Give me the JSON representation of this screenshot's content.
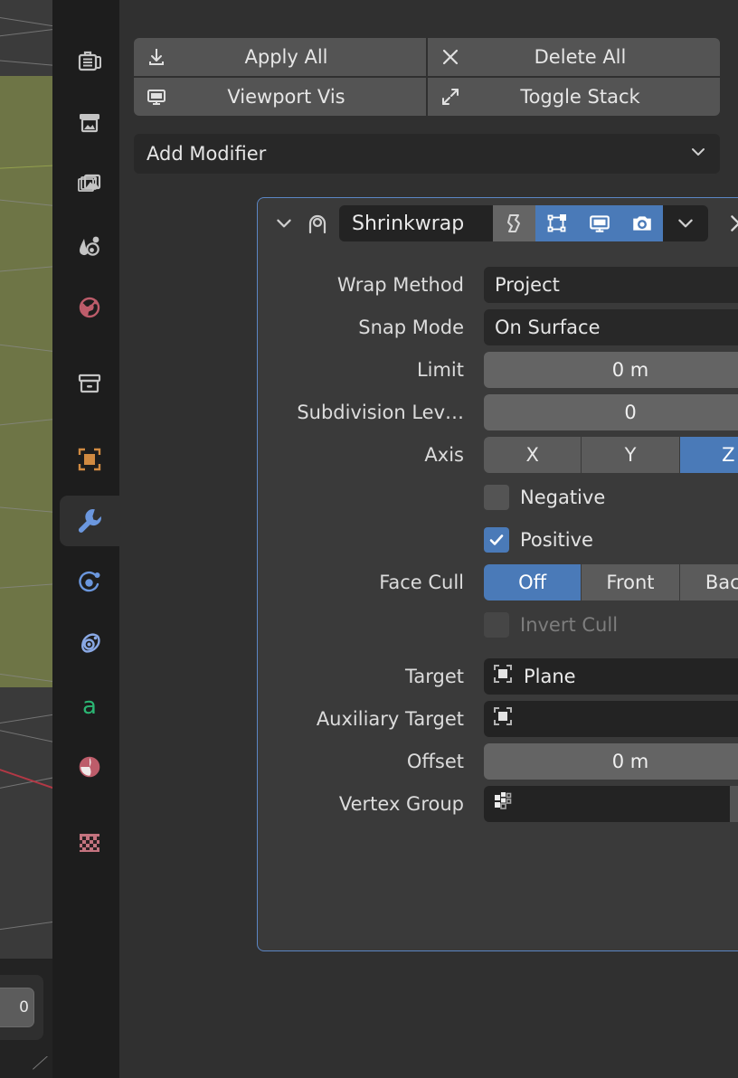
{
  "viewport": {
    "name": "3d-viewport-sliver",
    "object_color": "#6e7546",
    "wire_color": "#8b8b8b",
    "axis_line_color": "#b33845",
    "partial_button_text": "0"
  },
  "tabs": [
    {
      "name": "tab-tool",
      "icon": "tool-icon",
      "active": false
    },
    {
      "name": "tab-render",
      "icon": "render-icon",
      "active": false
    },
    {
      "name": "tab-output",
      "icon": "output-icon",
      "active": false
    },
    {
      "name": "tab-view-layer",
      "icon": "view-layer-icon",
      "active": false
    },
    {
      "name": "tab-scene",
      "icon": "scene-icon",
      "active": false
    },
    {
      "name": "tab-world",
      "icon": "world-icon",
      "active": false
    },
    {
      "name": "tab-collection",
      "icon": "collection-icon",
      "active": false
    },
    {
      "name": "tab-object",
      "icon": "object-icon",
      "active": false
    },
    {
      "name": "tab-modifiers",
      "icon": "wrench-icon",
      "active": true
    },
    {
      "name": "tab-particles",
      "icon": "particles-icon",
      "active": false
    },
    {
      "name": "tab-physics",
      "icon": "physics-icon",
      "active": false
    },
    {
      "name": "tab-object-data",
      "icon": "object-data-icon",
      "active": false
    },
    {
      "name": "tab-material",
      "icon": "material-icon",
      "active": false
    },
    {
      "name": "tab-texture",
      "icon": "texture-icon",
      "active": false
    }
  ],
  "toolbar": {
    "apply_all": "Apply All",
    "delete_all": "Delete All",
    "viewport_vis": "Viewport Vis",
    "toggle_stack": "Toggle Stack"
  },
  "add_modifier": {
    "label": "Add Modifier"
  },
  "modifier": {
    "name": "Shrinkwrap",
    "type_icon": "shrinkwrap-icon",
    "expanded": true,
    "toggles": [
      {
        "name": "edit-mode-toggle",
        "icon": "edit-mode-icon",
        "on": false
      },
      {
        "name": "on-cage-toggle",
        "icon": "on-cage-icon",
        "on": true
      },
      {
        "name": "realtime-toggle",
        "icon": "display-icon",
        "on": true
      },
      {
        "name": "render-toggle",
        "icon": "camera-icon",
        "on": true
      }
    ],
    "properties": {
      "wrap_method": {
        "label": "Wrap Method",
        "value": "Project"
      },
      "snap_mode": {
        "label": "Snap Mode",
        "value": "On Surface"
      },
      "limit": {
        "label": "Limit",
        "value": "0 m"
      },
      "subdivision": {
        "label": "Subdivision Lev…",
        "value": "0"
      },
      "axis": {
        "label": "Axis",
        "options": [
          "X",
          "Y",
          "Z"
        ],
        "selected": "Z"
      },
      "negative": {
        "label": "Negative",
        "checked": false
      },
      "positive": {
        "label": "Positive",
        "checked": true
      },
      "face_cull": {
        "label": "Face Cull",
        "options": [
          "Off",
          "Front",
          "Back"
        ],
        "selected": "Off"
      },
      "invert_cull": {
        "label": "Invert Cull",
        "checked": false,
        "disabled": true
      },
      "target": {
        "label": "Target",
        "value": "Plane",
        "icon": "object-data-icon"
      },
      "aux_target": {
        "label": "Auxiliary Target",
        "value": "",
        "icon": "object-data-icon"
      },
      "offset": {
        "label": "Offset",
        "value": "0 m"
      },
      "vertex_group": {
        "label": "Vertex Group",
        "value": "",
        "icon": "vertex-group-icon"
      }
    }
  },
  "colors": {
    "accent_blue": "#4a7ab8",
    "panel_border": "#5b86c4",
    "editor_bg": "#303030",
    "panel_bg": "#3a3a3a",
    "field_dark": "#282828",
    "field_light": "#646464",
    "text": "#e6e6e6"
  }
}
